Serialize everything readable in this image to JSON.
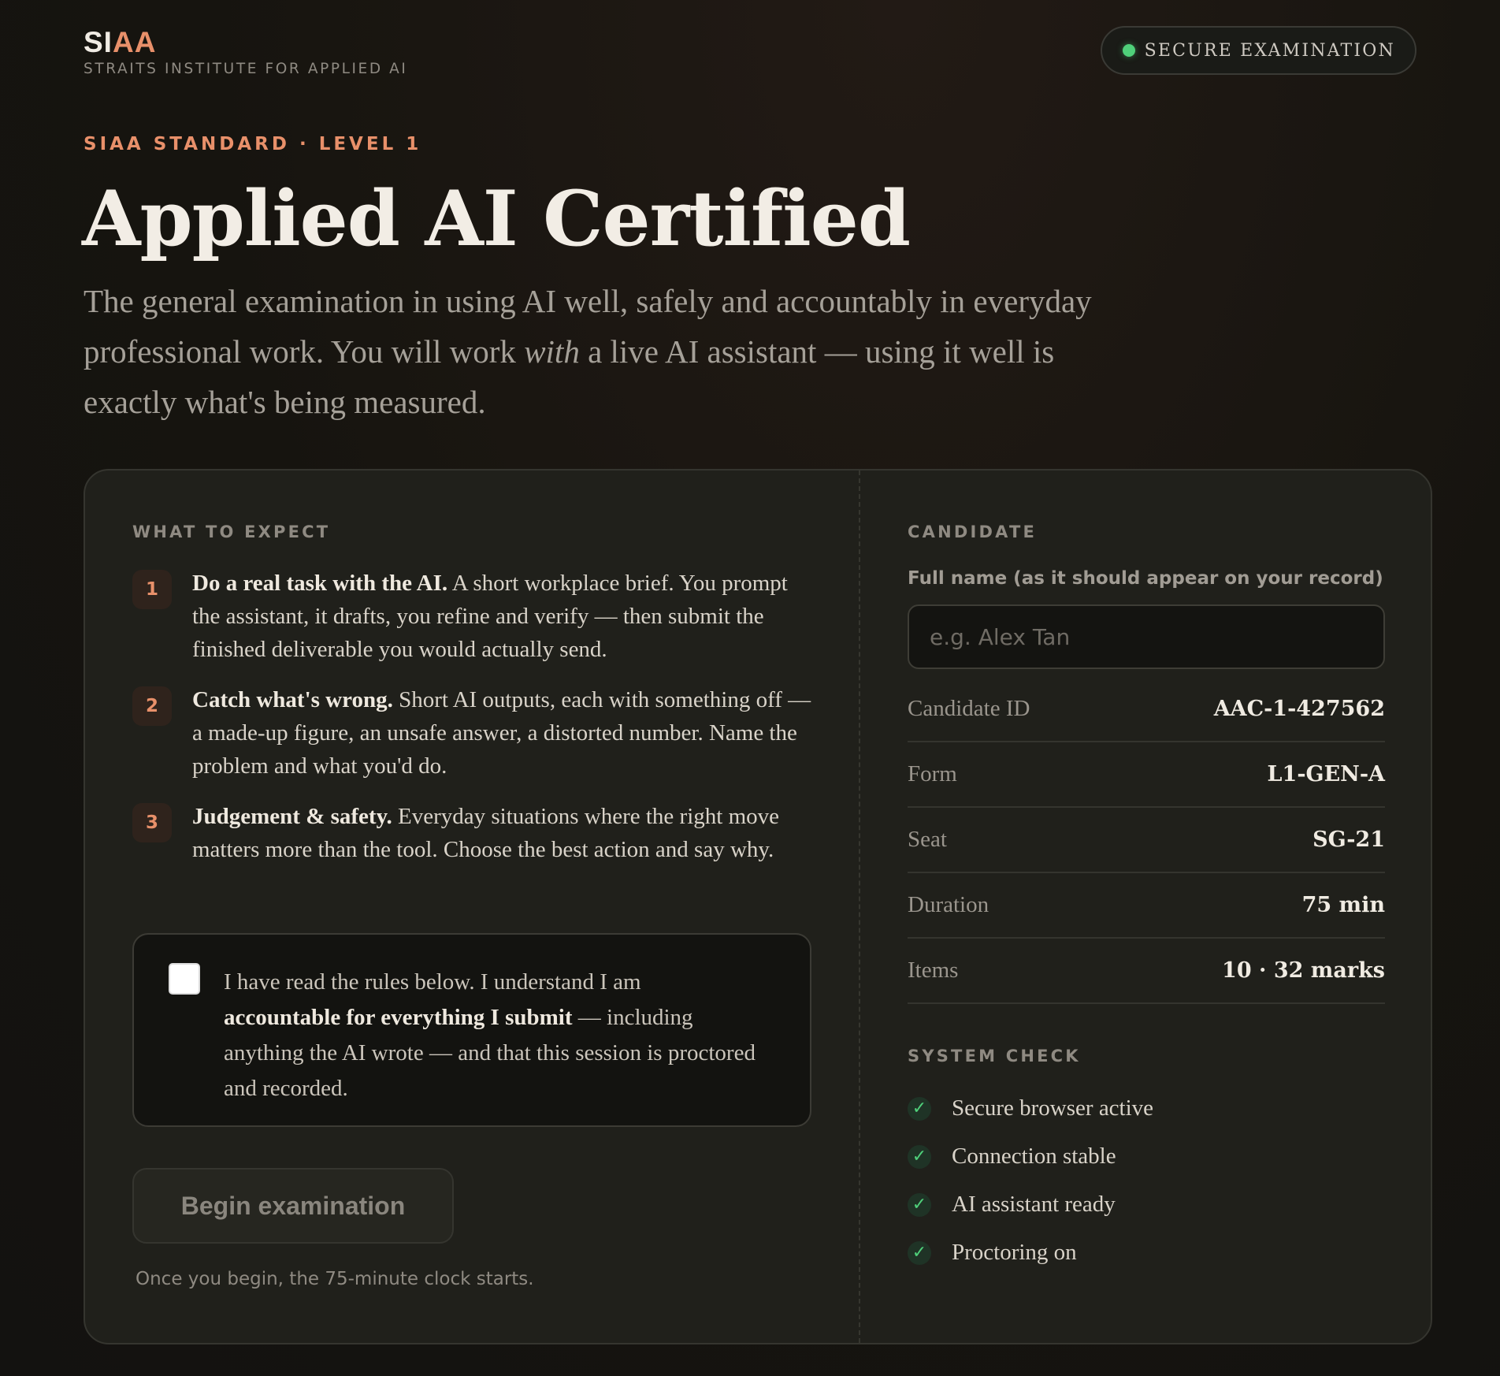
{
  "header": {
    "logo_prefix": "SI",
    "logo_accent": "AA",
    "org_name": "STRAITS INSTITUTE FOR APPLIED AI",
    "badge_label": "SECURE EXAMINATION"
  },
  "hero": {
    "eyebrow": "SIAA STANDARD · LEVEL 1",
    "title": "Applied AI Certified",
    "lede_part1": "The general examination in using AI well, safely and accountably in everyday professional work. You will work ",
    "lede_em": "with",
    "lede_part2": " a live AI assistant — using it well is exactly what's being measured."
  },
  "expect": {
    "label": "WHAT TO EXPECT",
    "steps": [
      {
        "num": "1",
        "title": "Do a real task with the AI.",
        "body": " A short workplace brief. You prompt the assistant, it drafts, you refine and verify — then submit the finished deliverable you would actually send."
      },
      {
        "num": "2",
        "title": "Catch what's wrong.",
        "body": " Short AI outputs, each with something off — a made-up figure, an unsafe answer, a distorted number. Name the problem and what you'd do."
      },
      {
        "num": "3",
        "title": "Judgement & safety.",
        "body": " Everyday situations where the right move matters more than the tool. Choose the best action and say why."
      }
    ],
    "ack_part1": "I have read the rules below. I understand I am ",
    "ack_bold": "accountable for everything I submit",
    "ack_part2": " — including anything the AI wrote — and that this session is proctored and recorded.",
    "begin_label": "Begin examination",
    "begin_note": "Once you begin, the 75-minute clock starts."
  },
  "candidate": {
    "label": "CANDIDATE",
    "name_label": "Full name (as it should appear on your record)",
    "name_placeholder": "e.g. Alex Tan",
    "name_value": "",
    "rows": [
      {
        "key": "Candidate ID",
        "value": "AAC-1-427562"
      },
      {
        "key": "Form",
        "value": "L1-GEN-A"
      },
      {
        "key": "Seat",
        "value": "SG-21"
      },
      {
        "key": "Duration",
        "value": "75 min"
      },
      {
        "key": "Items",
        "value": "10 · 32 marks"
      }
    ],
    "system_label": "SYSTEM CHECK",
    "checks": [
      {
        "mark": "✓",
        "text": "Secure browser active"
      },
      {
        "mark": "✓",
        "text": "Connection stable"
      },
      {
        "mark": "✓",
        "text": "AI assistant ready"
      },
      {
        "mark": "✓",
        "text": "Proctoring on"
      }
    ]
  },
  "colors": {
    "accent": "#e8906a",
    "success": "#4fd07a",
    "background": "#16140f",
    "card": "#20201b"
  },
  "icons": {
    "badge_dot": "status-dot-icon",
    "check": "checkmark-icon"
  }
}
